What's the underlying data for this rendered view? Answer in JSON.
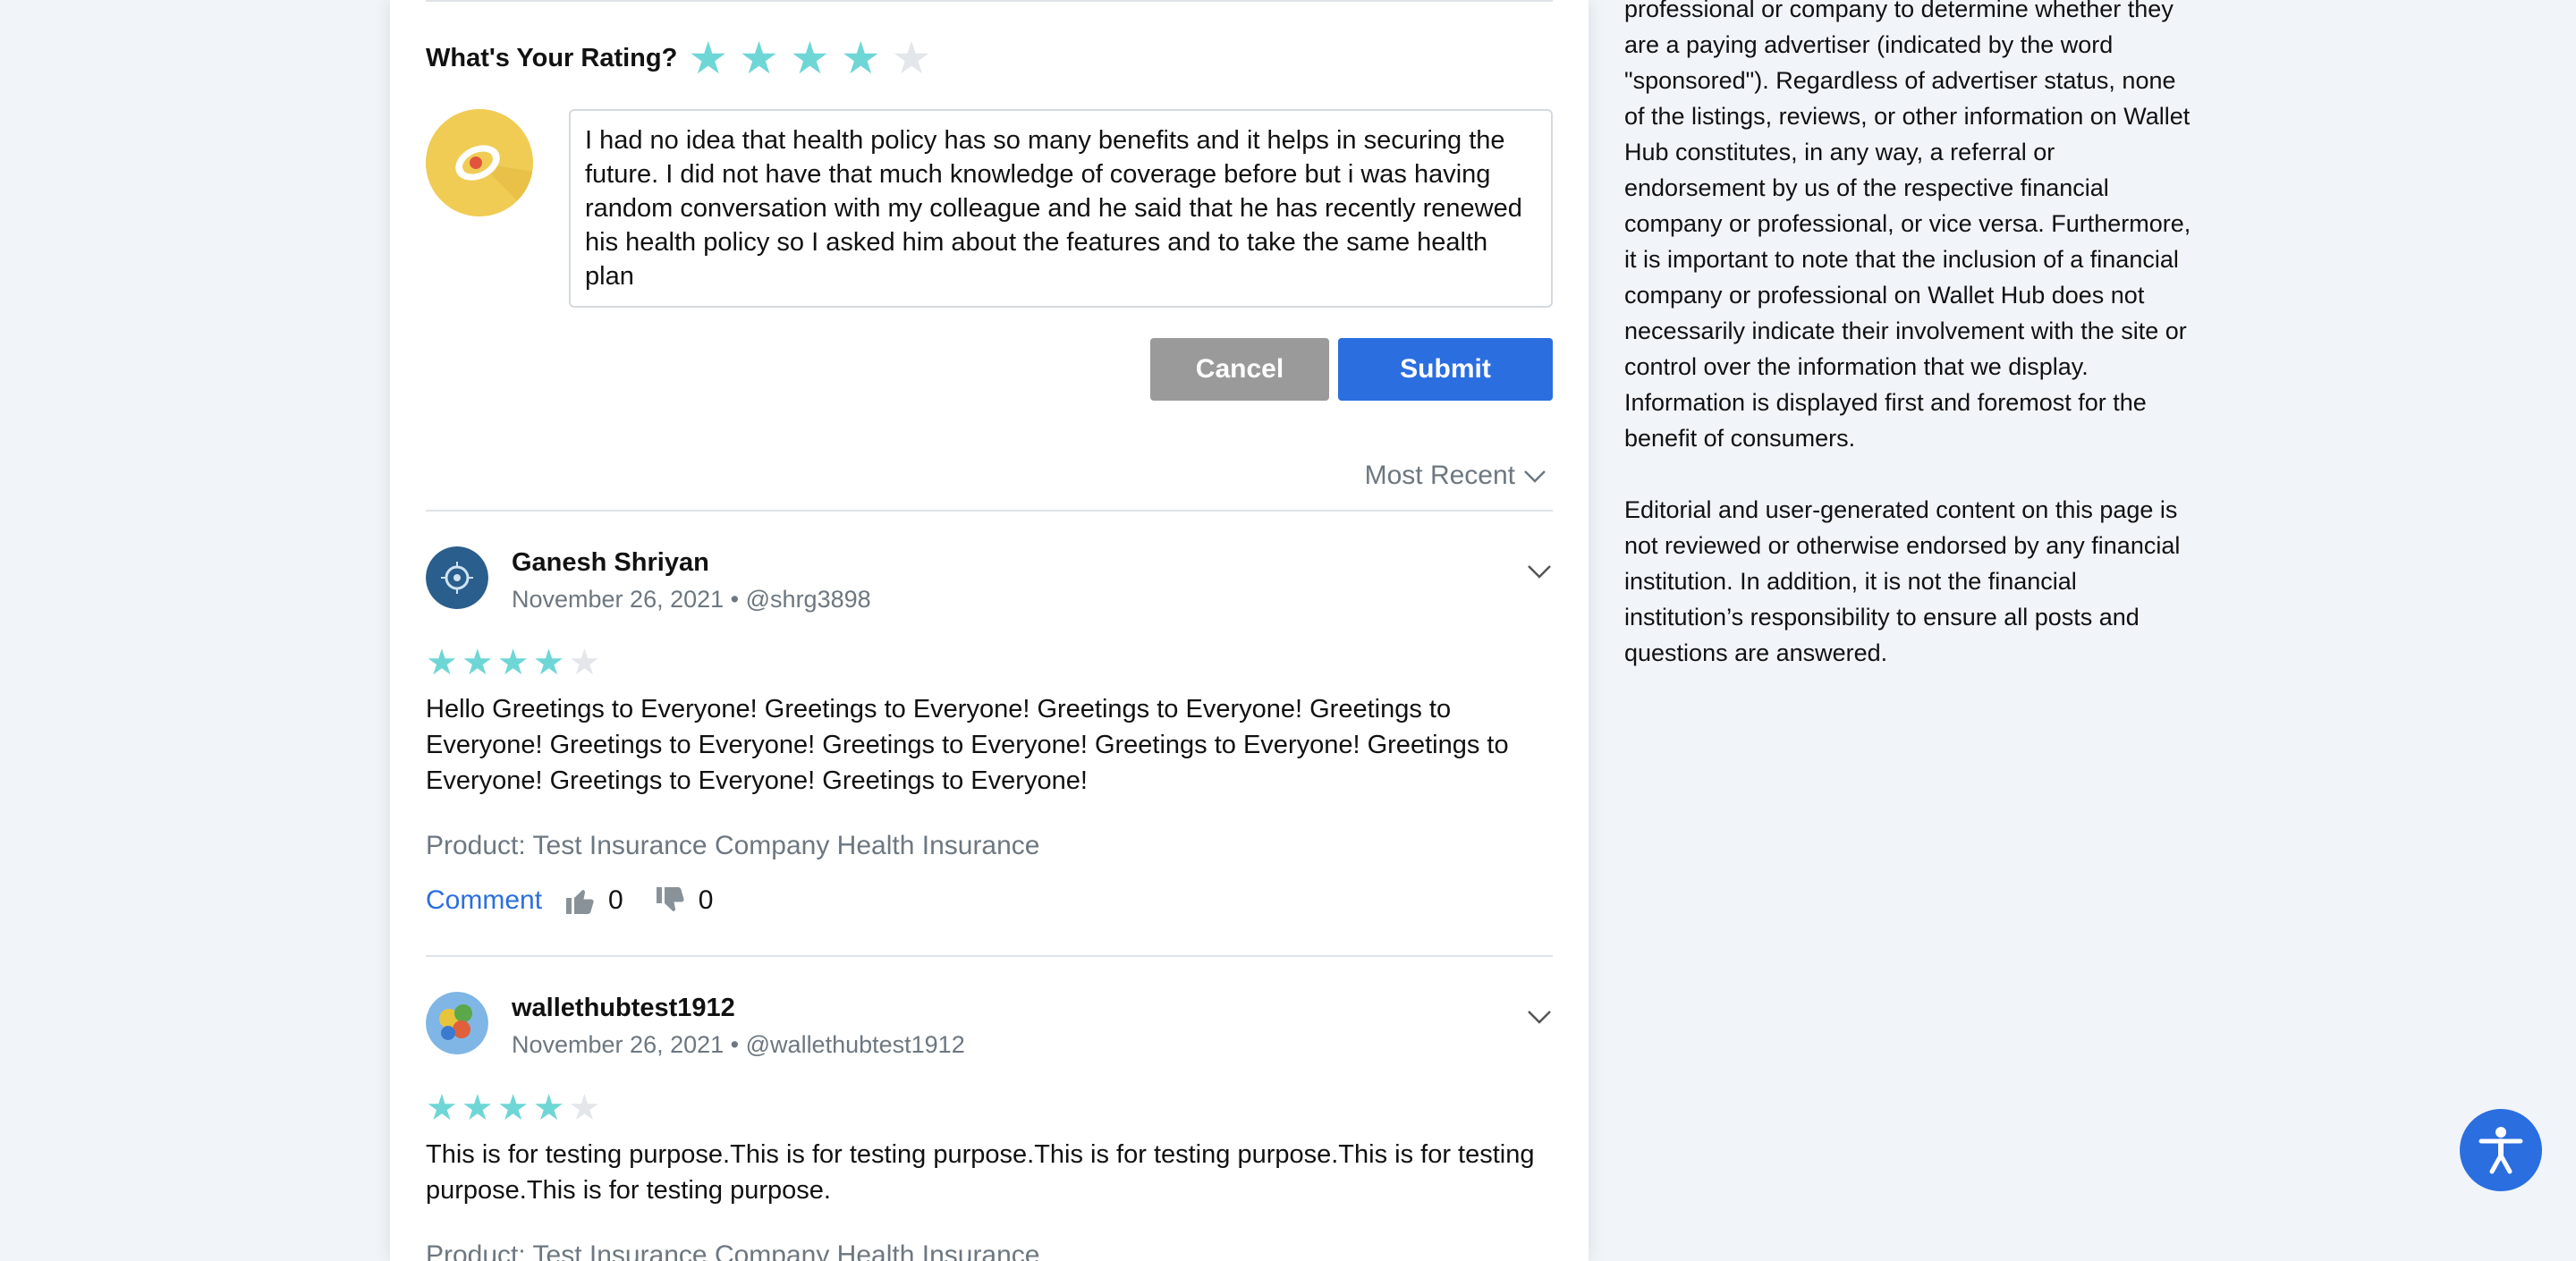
{
  "compose": {
    "rating_label": "What's Your Rating?",
    "rating": 4,
    "rating_max": 5,
    "text": "I had no idea that health policy has so many benefits and it helps in securing the future. I did not have that much knowledge of coverage before but i was having random conversation with my colleague and he said that he has recently renewed his health policy so I asked him about the features and to take the same health plan",
    "cancel_label": "Cancel",
    "submit_label": "Submit"
  },
  "sort": {
    "label": "Most Recent"
  },
  "reviews": [
    {
      "name": "Ganesh Shriyan",
      "date": "November 26, 2021",
      "separator": "•",
      "handle": "@shrg3898",
      "rating": 4,
      "text": "Hello Greetings to Everyone! Greetings to Everyone! Greetings to Everyone! Greetings to Everyone! Greetings to Everyone! Greetings to Everyone! Greetings to Everyone! Greetings to Everyone! Greetings to Everyone! Greetings to Everyone!",
      "product": "Product: Test Insurance Company Health Insurance",
      "comment_label": "Comment",
      "likes": "0",
      "dislikes": "0"
    },
    {
      "name": "wallethubtest1912",
      "date": "November 26, 2021",
      "separator": "•",
      "handle": "@wallethubtest1912",
      "rating": 4,
      "text": "This is for testing purpose.This is for testing purpose.This is for testing purpose.This is for testing purpose.This is for testing purpose.",
      "product": "Product: Test Insurance Company Health Insurance"
    }
  ],
  "sidebar": {
    "para1": "professional or company to determine whether they are a paying advertiser (indicated by the word \"sponsored\"). Regardless of advertiser status, none of the listings, reviews, or other information on Wallet Hub constitutes, in any way, a referral or endorsement by us of the respective financial company or professional, or vice versa. Furthermore, it is important to note that the inclusion of a financial company or professional on Wallet Hub does not necessarily indicate their involvement with the site or control over the information that we display. Information is displayed first and foremost for the benefit of consumers.",
    "para2": "Editorial and user-generated content on this page is not reviewed or otherwise endorsed by any financial institution. In addition, it is not the financial institution’s responsibility to ensure all posts and questions are answered."
  },
  "colors": {
    "star_on": "#6fd6d6",
    "star_off": "#e3e6ea",
    "primary": "#2b6ee0",
    "cancel": "#9a9a9a"
  },
  "icons": [
    "star-icon",
    "chevron-down-icon",
    "thumbs-up-icon",
    "thumbs-down-icon",
    "accessibility-icon"
  ]
}
